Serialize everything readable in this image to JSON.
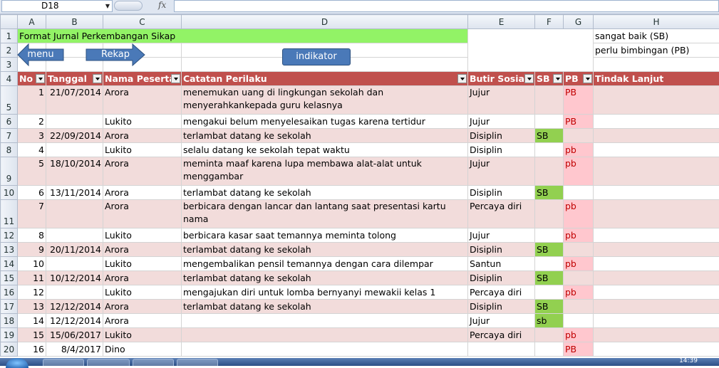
{
  "formula_bar": {
    "cell_ref": "D18",
    "fx": "fx",
    "formula": ""
  },
  "columns": [
    "A",
    "B",
    "C",
    "D",
    "E",
    "F",
    "G",
    "H"
  ],
  "sheet": {
    "title": "Format Jurnal Perkembangan Sikap",
    "legend_sb": "sangat baik (SB)",
    "legend_pb": "perlu bimbingan (PB)",
    "buttons": {
      "menu": "menu",
      "rekap": "Rekap",
      "indikator": "indikator"
    },
    "headers": [
      "No",
      "Tanggal",
      "Nama Peserta",
      "Catatan Perilaku",
      "Butir Sosial",
      "SB",
      "PB",
      "Tindak Lanjut"
    ],
    "rows": [
      {
        "row": "5",
        "no": "1",
        "tanggal": "21/07/2014",
        "nama": "Arora",
        "catatan": "menemukan uang di lingkungan sekolah dan menyerahkankepada guru kelasnya",
        "butir": "Jujur",
        "sb": "",
        "pb": "PB",
        "tindak": ""
      },
      {
        "row": "6",
        "no": "2",
        "tanggal": "",
        "nama": "Lukito",
        "catatan": "mengakui belum menyelesaikan  tugas karena tertidur",
        "butir": "Jujur",
        "sb": "",
        "pb": "PB",
        "tindak": ""
      },
      {
        "row": "7",
        "no": "3",
        "tanggal": "22/09/2014",
        "nama": "Arora",
        "catatan": "terlambat datang ke sekolah",
        "butir": "Disiplin",
        "sb": "SB",
        "pb": "",
        "tindak": ""
      },
      {
        "row": "8",
        "no": "4",
        "tanggal": "",
        "nama": "Lukito",
        "catatan": "selalu datang ke sekolah tepat waktu",
        "butir": "Disiplin",
        "sb": "",
        "pb": "pb",
        "tindak": ""
      },
      {
        "row": "9",
        "no": "5",
        "tanggal": "18/10/2014",
        "nama": "Arora",
        "catatan": "meminta maaf karena lupa membawa alat-alat untuk menggambar",
        "butir": "Jujur",
        "sb": "",
        "pb": "pb",
        "tindak": ""
      },
      {
        "row": "10",
        "no": "6",
        "tanggal": "13/11/2014",
        "nama": "Arora",
        "catatan": "terlambat datang ke sekolah",
        "butir": "Disiplin",
        "sb": "SB",
        "pb": "",
        "tindak": ""
      },
      {
        "row": "11",
        "no": "7",
        "tanggal": "",
        "nama": "Arora",
        "catatan": "berbicara dengan lancar dan lantang saat presentasi kartu nama",
        "butir": "Percaya diri",
        "sb": "",
        "pb": "pb",
        "tindak": ""
      },
      {
        "row": "12",
        "no": "8",
        "tanggal": "",
        "nama": "Lukito",
        "catatan": "berbicara kasar saat temannya meminta tolong",
        "butir": "Jujur",
        "sb": "",
        "pb": "pb",
        "tindak": ""
      },
      {
        "row": "13",
        "no": "9",
        "tanggal": "20/11/2014",
        "nama": "Arora",
        "catatan": "terlambat datang ke sekolah",
        "butir": "Disiplin",
        "sb": "SB",
        "pb": "",
        "tindak": ""
      },
      {
        "row": "14",
        "no": "10",
        "tanggal": "",
        "nama": "Lukito",
        "catatan": "mengembalikan pensil temannya dengan cara dilempar",
        "butir": "Santun",
        "sb": "",
        "pb": "pb",
        "tindak": ""
      },
      {
        "row": "15",
        "no": "11",
        "tanggal": "10/12/2014",
        "nama": "Arora",
        "catatan": "terlambat datang ke sekolah",
        "butir": "Disiplin",
        "sb": "SB",
        "pb": "",
        "tindak": ""
      },
      {
        "row": "16",
        "no": "12",
        "tanggal": "",
        "nama": "Lukito",
        "catatan": "mengajukan diri untuk lomba bernyanyi mewakii kelas 1",
        "butir": "Percaya diri",
        "sb": "",
        "pb": "pb",
        "tindak": ""
      },
      {
        "row": "17",
        "no": "13",
        "tanggal": "12/12/2014",
        "nama": "Arora",
        "catatan": "terlambat datang ke sekolah",
        "butir": "Disiplin",
        "sb": "SB",
        "pb": "",
        "tindak": ""
      },
      {
        "row": "18",
        "no": "14",
        "tanggal": "12/12/2014",
        "nama": "Arora",
        "catatan": "",
        "butir": "Jujur",
        "sb": "sb",
        "pb": "",
        "tindak": ""
      },
      {
        "row": "19",
        "no": "15",
        "tanggal": "15/06/2017",
        "nama": "Lukito",
        "catatan": "",
        "butir": "Percaya diri",
        "sb": "",
        "pb": "pb",
        "tindak": ""
      },
      {
        "row": "20",
        "no": "16",
        "tanggal": "8/4/2017",
        "nama": "Dino",
        "catatan": "",
        "butir": "",
        "sb": "",
        "pb": "PB",
        "tindak": ""
      }
    ]
  },
  "taskbar": {
    "clock": "14:39"
  },
  "colors": {
    "header_red": "#c0504d",
    "title_green": "#92f366",
    "sb_green": "#92d050",
    "pb_pink": "#ffc7ce",
    "band_pink": "#f2dcdb",
    "shape_blue": "#4a79b8"
  }
}
